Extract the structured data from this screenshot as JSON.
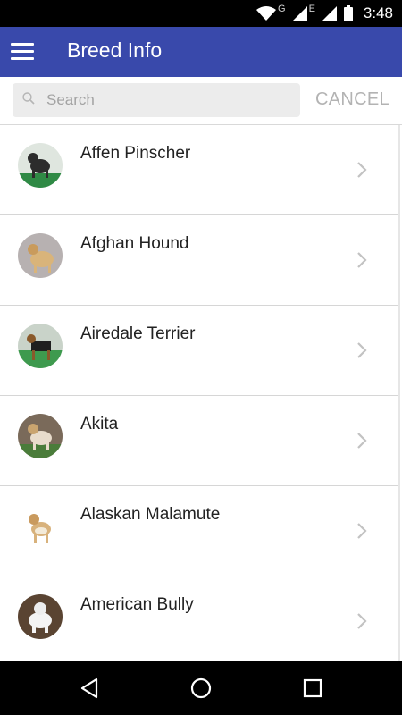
{
  "status_bar": {
    "time": "3:48",
    "network_label_1": "G",
    "network_label_2": "E",
    "icons": [
      "wifi-icon",
      "signal-icon",
      "signal-icon",
      "battery-icon"
    ]
  },
  "app_bar": {
    "title": "Breed Info",
    "menu_icon": "hamburger-menu-icon"
  },
  "search": {
    "placeholder": "Search",
    "value": "",
    "cancel_label": "CANCEL"
  },
  "breeds": [
    {
      "name": "Affen Pinscher",
      "thumb": "affen-pinscher-photo"
    },
    {
      "name": "Afghan Hound",
      "thumb": "afghan-hound-photo"
    },
    {
      "name": "Airedale Terrier",
      "thumb": "airedale-terrier-photo"
    },
    {
      "name": "Akita",
      "thumb": "akita-photo"
    },
    {
      "name": "Alaskan Malamute",
      "thumb": "alaskan-malamute-photo"
    },
    {
      "name": "American Bully",
      "thumb": "american-bully-photo"
    }
  ],
  "nav": [
    "back-icon",
    "home-icon",
    "recents-icon"
  ],
  "colors": {
    "app_bar": "#3949ab",
    "status_bar": "#000000",
    "cancel_text": "#b3b3b3",
    "divider": "#d6d6d6"
  }
}
